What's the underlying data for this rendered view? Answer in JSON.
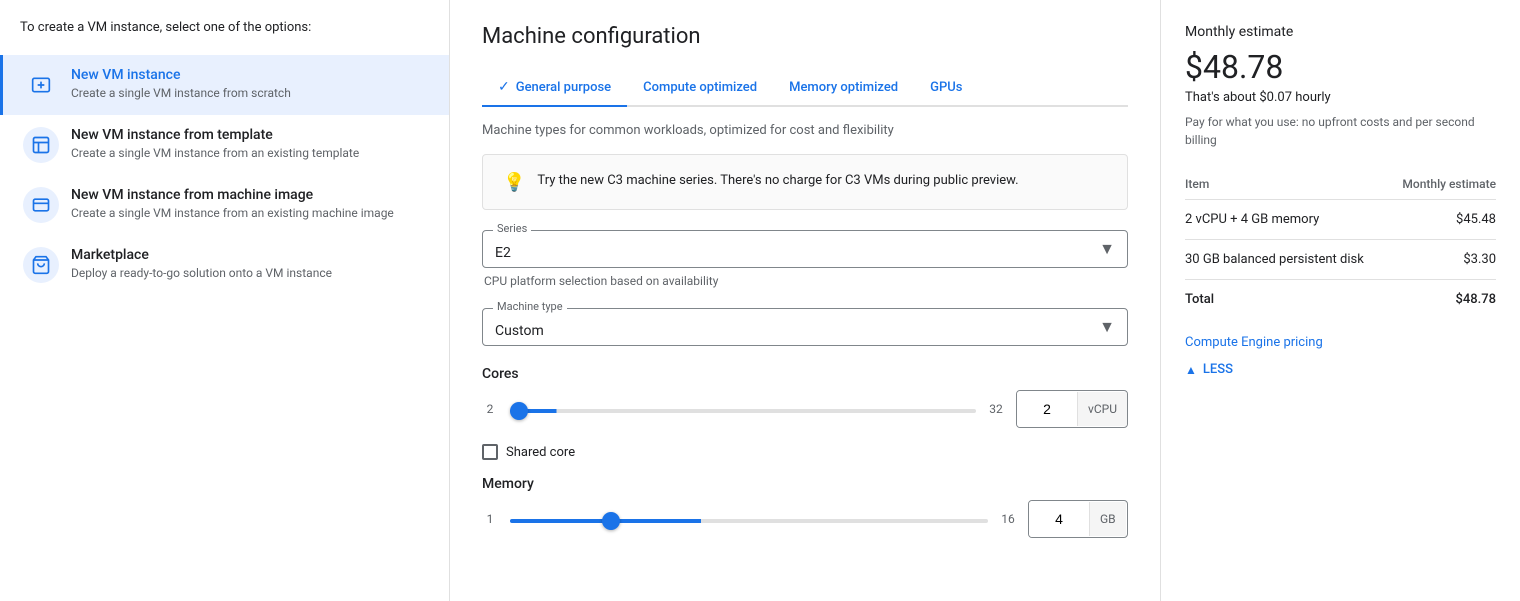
{
  "sidebar": {
    "intro": "To create a VM instance, select one of the options:",
    "items": [
      {
        "id": "new-vm",
        "title": "New VM instance",
        "desc": "Create a single VM instance from scratch",
        "active": true
      },
      {
        "id": "new-vm-template",
        "title": "New VM instance from template",
        "desc": "Create a single VM instance from an existing template",
        "active": false
      },
      {
        "id": "new-vm-machine-image",
        "title": "New VM instance from machine image",
        "desc": "Create a single VM instance from an existing machine image",
        "active": false
      },
      {
        "id": "marketplace",
        "title": "Marketplace",
        "desc": "Deploy a ready-to-go solution onto a VM instance",
        "active": false
      }
    ]
  },
  "main": {
    "page_title": "Machine configuration",
    "tabs": [
      {
        "id": "general-purpose",
        "label": "General purpose",
        "active": true,
        "has_check": true
      },
      {
        "id": "compute-optimized",
        "label": "Compute optimized",
        "active": false,
        "has_check": false
      },
      {
        "id": "memory-optimized",
        "label": "Memory optimized",
        "active": false,
        "has_check": false
      },
      {
        "id": "gpus",
        "label": "GPUs",
        "active": false,
        "has_check": false
      }
    ],
    "machine_subtitle": "Machine types for common workloads, optimized for cost and flexibility",
    "info_banner": {
      "icon": "💡",
      "text": "Try the new C3 machine series. There's no charge for C3 VMs during public preview."
    },
    "series_field": {
      "label": "Series",
      "value": "E2"
    },
    "machine_type_field": {
      "label": "Machine type",
      "value": "Custom"
    },
    "cpu_hint": "CPU platform selection based on availability",
    "cores": {
      "label": "Cores",
      "min": "2",
      "max": "32",
      "value": "2",
      "unit": "vCPU",
      "slider_percent": 10
    },
    "shared_core_label": "Shared core",
    "memory": {
      "label": "Memory",
      "min": "1",
      "max": "16",
      "value": "4",
      "unit": "GB",
      "slider_percent": 40
    }
  },
  "right_panel": {
    "title": "Monthly estimate",
    "price": "$48.78",
    "hourly": "That's about $0.07 hourly",
    "note": "Pay for what you use: no upfront costs and per second billing",
    "table": {
      "col1": "Item",
      "col2": "Monthly estimate",
      "rows": [
        {
          "item": "2 vCPU + 4 GB memory",
          "estimate": "$45.48"
        },
        {
          "item": "30 GB balanced persistent disk",
          "estimate": "$3.30"
        }
      ],
      "total_label": "Total",
      "total_value": "$48.78"
    },
    "pricing_link": "Compute Engine pricing",
    "less_label": "LESS"
  }
}
